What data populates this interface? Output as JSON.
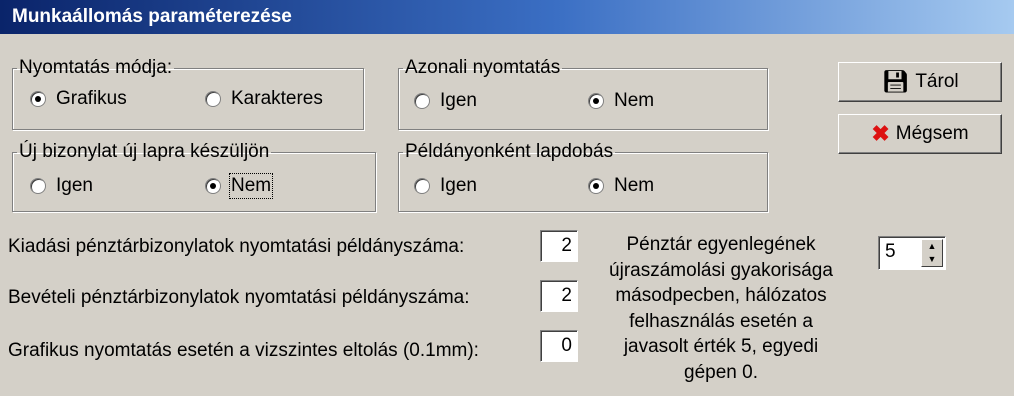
{
  "window": {
    "title": "Munkaállomás paraméterezése"
  },
  "groups": {
    "mode": {
      "legend": "Nyomtatás módja:",
      "options": [
        "Grafikus",
        "Karakteres"
      ]
    },
    "inline": {
      "legend": "Azonali nyomtatás",
      "options": [
        "Igen",
        "Nem"
      ]
    },
    "newpage": {
      "legend": "Új bizonylat új lapra készüljön",
      "options": [
        "Igen",
        "Nem"
      ]
    },
    "eject": {
      "legend": "Példányonként lapdobás",
      "options": [
        "Igen",
        "Nem"
      ]
    }
  },
  "buttons": {
    "save": "Tárol",
    "cancel": "Mégsem"
  },
  "fields": {
    "expense": {
      "label": "Kiadási pénztárbizonylatok nyomtatási példányszáma:",
      "value": "2"
    },
    "income": {
      "label": "Bevételi pénztárbizonylatok nyomtatási példányszáma:",
      "value": "2"
    },
    "offset": {
      "label": "Grafikus nyomtatás esetén a vizszintes eltolás (0.1mm):",
      "value": "0"
    }
  },
  "note": [
    "Pénztár egyenlegének",
    "újraszámolási gyakorisága",
    "másodpecben, hálózatos",
    "felhasználás esetén a",
    "javasolt érték 5, egyedi",
    "gépen 0."
  ],
  "spinner": {
    "value": "5"
  }
}
